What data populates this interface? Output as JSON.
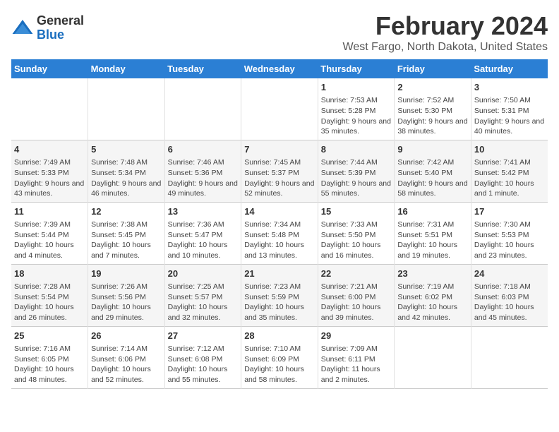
{
  "logo": {
    "general": "General",
    "blue": "Blue"
  },
  "title": "February 2024",
  "subtitle": "West Fargo, North Dakota, United States",
  "weekdays": [
    "Sunday",
    "Monday",
    "Tuesday",
    "Wednesday",
    "Thursday",
    "Friday",
    "Saturday"
  ],
  "weeks": [
    [
      {
        "day": "",
        "info": ""
      },
      {
        "day": "",
        "info": ""
      },
      {
        "day": "",
        "info": ""
      },
      {
        "day": "",
        "info": ""
      },
      {
        "day": "1",
        "info": "Sunrise: 7:53 AM\nSunset: 5:28 PM\nDaylight: 9 hours and 35 minutes."
      },
      {
        "day": "2",
        "info": "Sunrise: 7:52 AM\nSunset: 5:30 PM\nDaylight: 9 hours and 38 minutes."
      },
      {
        "day": "3",
        "info": "Sunrise: 7:50 AM\nSunset: 5:31 PM\nDaylight: 9 hours and 40 minutes."
      }
    ],
    [
      {
        "day": "4",
        "info": "Sunrise: 7:49 AM\nSunset: 5:33 PM\nDaylight: 9 hours and 43 minutes."
      },
      {
        "day": "5",
        "info": "Sunrise: 7:48 AM\nSunset: 5:34 PM\nDaylight: 9 hours and 46 minutes."
      },
      {
        "day": "6",
        "info": "Sunrise: 7:46 AM\nSunset: 5:36 PM\nDaylight: 9 hours and 49 minutes."
      },
      {
        "day": "7",
        "info": "Sunrise: 7:45 AM\nSunset: 5:37 PM\nDaylight: 9 hours and 52 minutes."
      },
      {
        "day": "8",
        "info": "Sunrise: 7:44 AM\nSunset: 5:39 PM\nDaylight: 9 hours and 55 minutes."
      },
      {
        "day": "9",
        "info": "Sunrise: 7:42 AM\nSunset: 5:40 PM\nDaylight: 9 hours and 58 minutes."
      },
      {
        "day": "10",
        "info": "Sunrise: 7:41 AM\nSunset: 5:42 PM\nDaylight: 10 hours and 1 minute."
      }
    ],
    [
      {
        "day": "11",
        "info": "Sunrise: 7:39 AM\nSunset: 5:44 PM\nDaylight: 10 hours and 4 minutes."
      },
      {
        "day": "12",
        "info": "Sunrise: 7:38 AM\nSunset: 5:45 PM\nDaylight: 10 hours and 7 minutes."
      },
      {
        "day": "13",
        "info": "Sunrise: 7:36 AM\nSunset: 5:47 PM\nDaylight: 10 hours and 10 minutes."
      },
      {
        "day": "14",
        "info": "Sunrise: 7:34 AM\nSunset: 5:48 PM\nDaylight: 10 hours and 13 minutes."
      },
      {
        "day": "15",
        "info": "Sunrise: 7:33 AM\nSunset: 5:50 PM\nDaylight: 10 hours and 16 minutes."
      },
      {
        "day": "16",
        "info": "Sunrise: 7:31 AM\nSunset: 5:51 PM\nDaylight: 10 hours and 19 minutes."
      },
      {
        "day": "17",
        "info": "Sunrise: 7:30 AM\nSunset: 5:53 PM\nDaylight: 10 hours and 23 minutes."
      }
    ],
    [
      {
        "day": "18",
        "info": "Sunrise: 7:28 AM\nSunset: 5:54 PM\nDaylight: 10 hours and 26 minutes."
      },
      {
        "day": "19",
        "info": "Sunrise: 7:26 AM\nSunset: 5:56 PM\nDaylight: 10 hours and 29 minutes."
      },
      {
        "day": "20",
        "info": "Sunrise: 7:25 AM\nSunset: 5:57 PM\nDaylight: 10 hours and 32 minutes."
      },
      {
        "day": "21",
        "info": "Sunrise: 7:23 AM\nSunset: 5:59 PM\nDaylight: 10 hours and 35 minutes."
      },
      {
        "day": "22",
        "info": "Sunrise: 7:21 AM\nSunset: 6:00 PM\nDaylight: 10 hours and 39 minutes."
      },
      {
        "day": "23",
        "info": "Sunrise: 7:19 AM\nSunset: 6:02 PM\nDaylight: 10 hours and 42 minutes."
      },
      {
        "day": "24",
        "info": "Sunrise: 7:18 AM\nSunset: 6:03 PM\nDaylight: 10 hours and 45 minutes."
      }
    ],
    [
      {
        "day": "25",
        "info": "Sunrise: 7:16 AM\nSunset: 6:05 PM\nDaylight: 10 hours and 48 minutes."
      },
      {
        "day": "26",
        "info": "Sunrise: 7:14 AM\nSunset: 6:06 PM\nDaylight: 10 hours and 52 minutes."
      },
      {
        "day": "27",
        "info": "Sunrise: 7:12 AM\nSunset: 6:08 PM\nDaylight: 10 hours and 55 minutes."
      },
      {
        "day": "28",
        "info": "Sunrise: 7:10 AM\nSunset: 6:09 PM\nDaylight: 10 hours and 58 minutes."
      },
      {
        "day": "29",
        "info": "Sunrise: 7:09 AM\nSunset: 6:11 PM\nDaylight: 11 hours and 2 minutes."
      },
      {
        "day": "",
        "info": ""
      },
      {
        "day": "",
        "info": ""
      }
    ]
  ]
}
